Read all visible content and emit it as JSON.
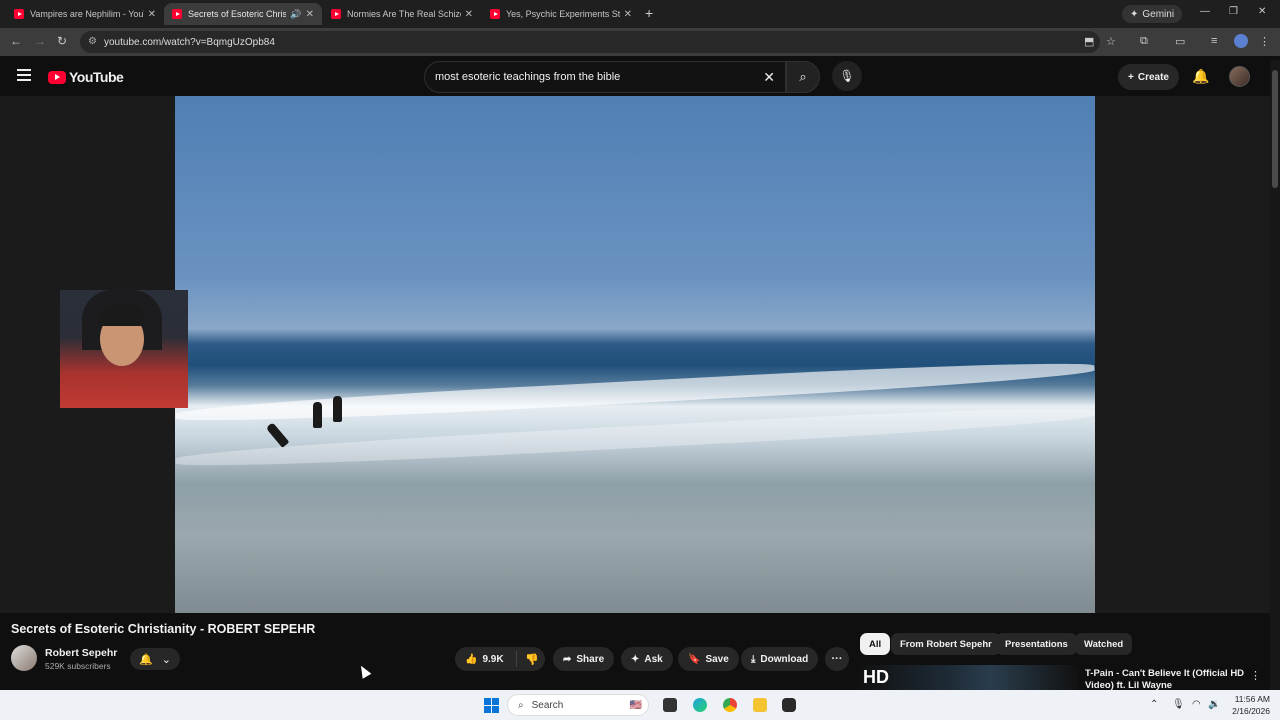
{
  "browser": {
    "tabs": [
      {
        "title": "Vampires are Nephilim - YouTube",
        "active": false
      },
      {
        "title": "Secrets of Esoteric Christianity",
        "active": true
      },
      {
        "title": "Normies Are The Real Schizos",
        "active": false
      },
      {
        "title": "Yes, Psychic Experiments Still H",
        "active": false
      }
    ],
    "gemini_label": "Gemini",
    "url": "youtube.com/watch?v=BqmgUzOpb84"
  },
  "youtube": {
    "logo_text": "YouTube",
    "search_value": "most esoteric teachings from the bible",
    "create_label": "Create"
  },
  "video": {
    "title": "Secrets of Esoteric Christianity - ROBERT SEPEHR",
    "channel_name": "Robert Sepehr",
    "subscribers": "529K subscribers",
    "like_count": "9.9K",
    "share_label": "Share",
    "ask_label": "Ask",
    "save_label": "Save",
    "download_label": "Download"
  },
  "sidebar": {
    "chips": [
      "All",
      "From Robert Sepehr",
      "Presentations",
      "Watched"
    ],
    "recommendation": {
      "thumb_text": "HD",
      "title": "T-Pain - Can't Believe It (Official HD Video) ft. Lil Wayne"
    }
  },
  "taskbar": {
    "search_placeholder": "Search",
    "time": "11:56 AM",
    "date": "2/16/2026"
  },
  "colors": {
    "accent": "#ff0033",
    "background": "#0f0f0f",
    "pill": "#272727"
  }
}
